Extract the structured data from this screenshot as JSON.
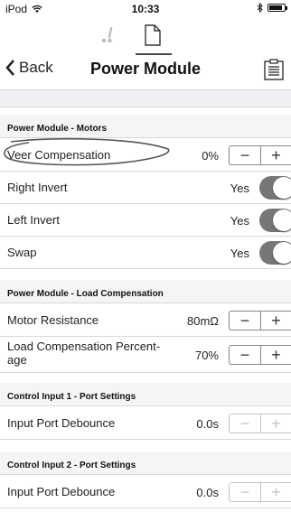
{
  "status": {
    "carrier": "iPod",
    "time": "10:33"
  },
  "nav": {
    "back_label": "Back",
    "title": "Power Module"
  },
  "sections": {
    "motors": {
      "title": "Power Module - Motors",
      "veer": {
        "label": "Veer Compensation",
        "value": "0%"
      },
      "right_invert": {
        "label": "Right Invert",
        "value": "Yes"
      },
      "left_invert": {
        "label": "Left Invert",
        "value": "Yes"
      },
      "swap": {
        "label": "Swap",
        "value": "Yes"
      }
    },
    "load": {
      "title": "Power Module - Load Compensation",
      "motor_resistance": {
        "label": "Motor Resistance",
        "value": "80mΩ"
      },
      "load_percentage": {
        "label": "Load Compensation Percent-age",
        "value": "70%"
      }
    },
    "input1": {
      "title": "Control Input 1 - Port Settings",
      "debounce": {
        "label": "Input Port Debounce",
        "value": "0.0s"
      }
    },
    "input2": {
      "title": "Control Input 2 - Port Settings",
      "debounce": {
        "label": "Input Port Debounce",
        "value": "0.0s"
      }
    }
  },
  "stepper": {
    "minus": "−",
    "plus": "+"
  },
  "icons": {
    "wifi": "wifi-icon",
    "bluetooth": "bluetooth-icon",
    "battery": "battery-icon",
    "back": "chevron-left-icon",
    "tab_left": "wheelchair-icon",
    "tab_right": "document-icon",
    "nav_right": "clipboard-icon"
  },
  "colors": {
    "toggle_on": "#777777",
    "section_bg": "#f5f5f7",
    "separator": "#d8d8dc"
  },
  "toggles": {
    "right_invert_on": true,
    "left_invert_on": true,
    "swap_on": true
  },
  "battery_level": 0.85
}
